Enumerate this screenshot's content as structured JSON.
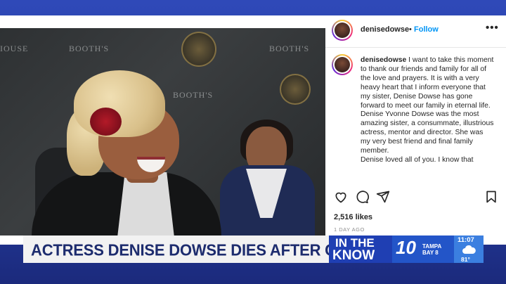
{
  "instagram": {
    "username": "denisedowse",
    "separator": "•",
    "follow_label": "Follow",
    "more_label": "•••",
    "caption_user": "denisedowse",
    "caption_p1": " I want to take this moment to thank our friends and family for all of the love and prayers. It is with a very heavy heart that I inform everyone that my sister, Denise Dowse has gone forward to meet our family in eternal life.",
    "caption_p2": "Denise Yvonne Dowse was the most amazing sister, a consummate, illustrious actress, mentor and director. She was my very best friend and final family member.",
    "caption_p3": "Denise loved all of you. I know that",
    "icons": [
      "heart-icon",
      "comment-icon",
      "share-icon",
      "bookmark-icon"
    ],
    "likes": "2,516 likes",
    "date": "1 DAY AGO"
  },
  "photo": {
    "wall_texts": [
      "IOUSE",
      "BOOTH'S",
      "BOOTH'S",
      "BOOTH'S"
    ]
  },
  "lower_third": {
    "headline": "ACTRESS DENISE DOWSE DIES AFTER COMA",
    "show_line1": "IN THE",
    "show_line2": "KNOW",
    "station_number": "10",
    "station_city1": "TAMPA",
    "station_city2": "BAY 8",
    "time": "11:07",
    "temperature": "81°"
  },
  "colors": {
    "follow": "#0095f6",
    "headline_text": "#1d2c6e",
    "show_bg": "#1f3fb3",
    "station_bg": "#2355c8",
    "weather_bg": "#3b7fe0"
  }
}
